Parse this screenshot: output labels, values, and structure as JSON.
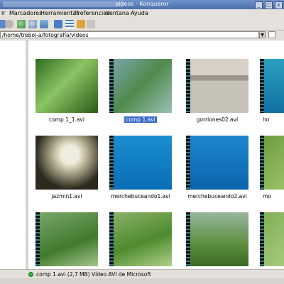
{
  "window": {
    "title": "videos - Konqueror"
  },
  "menu": {
    "items": [
      "lr",
      "Marcadores",
      "Herramientas",
      "Preferencias",
      "Ventana",
      "Ayuda"
    ]
  },
  "location": {
    "value": "/home/trebol-a/fotografía/videos"
  },
  "files": [
    {
      "name": "comp 1_1.avi",
      "selected": false
    },
    {
      "name": "comp 1.avi",
      "selected": true
    },
    {
      "name": "gorriones02.avi",
      "selected": false
    },
    {
      "name": "ho",
      "selected": false
    },
    {
      "name": "jazmin1.avi",
      "selected": false
    },
    {
      "name": "merchebuceando1.avi",
      "selected": false
    },
    {
      "name": "merchebuceando2.avi",
      "selected": false
    },
    {
      "name": "mo",
      "selected": false
    },
    {
      "name": "",
      "selected": false
    },
    {
      "name": "",
      "selected": false
    },
    {
      "name": "",
      "selected": false
    },
    {
      "name": "",
      "selected": false
    }
  ],
  "status": {
    "text": "comp 1.avi (2,7 MB)  Vídeo AVI de Microsoft"
  },
  "colors": {
    "selection": "#3a6bc9",
    "film_strip": "#3c7f8a",
    "status_ok": "#3bb33b"
  }
}
